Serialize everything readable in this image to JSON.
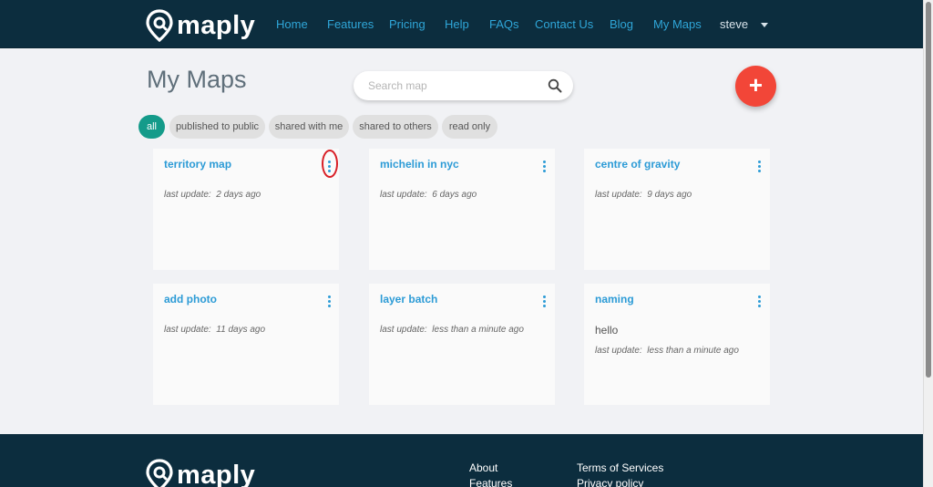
{
  "brand": {
    "name": "maply"
  },
  "nav": {
    "items": [
      "Home",
      "Features",
      "Pricing",
      "Help",
      "FAQs",
      "Contact Us",
      "Blog",
      "My Maps"
    ],
    "user": "steve"
  },
  "page": {
    "title": "My Maps",
    "search_placeholder": "Search map",
    "add_symbol": "+"
  },
  "filters": [
    {
      "label": "all",
      "active": true
    },
    {
      "label": "published to public",
      "active": false
    },
    {
      "label": "shared with me",
      "active": false
    },
    {
      "label": "shared to others",
      "active": false
    },
    {
      "label": "read only",
      "active": false
    }
  ],
  "maps": [
    {
      "title": "territory map",
      "description": "",
      "meta_label": "last update:",
      "updated": "2 days ago"
    },
    {
      "title": "michelin in nyc",
      "description": "",
      "meta_label": "last update:",
      "updated": "6 days ago"
    },
    {
      "title": "centre of gravity",
      "description": "",
      "meta_label": "last update:",
      "updated": "9 days ago"
    },
    {
      "title": "add photo",
      "description": "",
      "meta_label": "last update:",
      "updated": "11 days ago"
    },
    {
      "title": "layer batch",
      "description": "",
      "meta_label": "last update:",
      "updated": "less than a minute ago"
    },
    {
      "title": "naming",
      "description": "hello",
      "meta_label": "last update:",
      "updated": "less than a minute ago"
    }
  ],
  "footer": {
    "col1": [
      "About",
      "Features"
    ],
    "col2": [
      "Terms of Services",
      "Privacy policy"
    ]
  },
  "colors": {
    "header_bg": "#0c2d3e",
    "link": "#2fa6d8",
    "active_chip": "#149b8a",
    "fab": "#f24638",
    "highlight": "#d81f26"
  },
  "icons": [
    "logo-pin-icon",
    "search-icon",
    "plus-icon",
    "more-vertical-icon",
    "chevron-down-icon"
  ]
}
